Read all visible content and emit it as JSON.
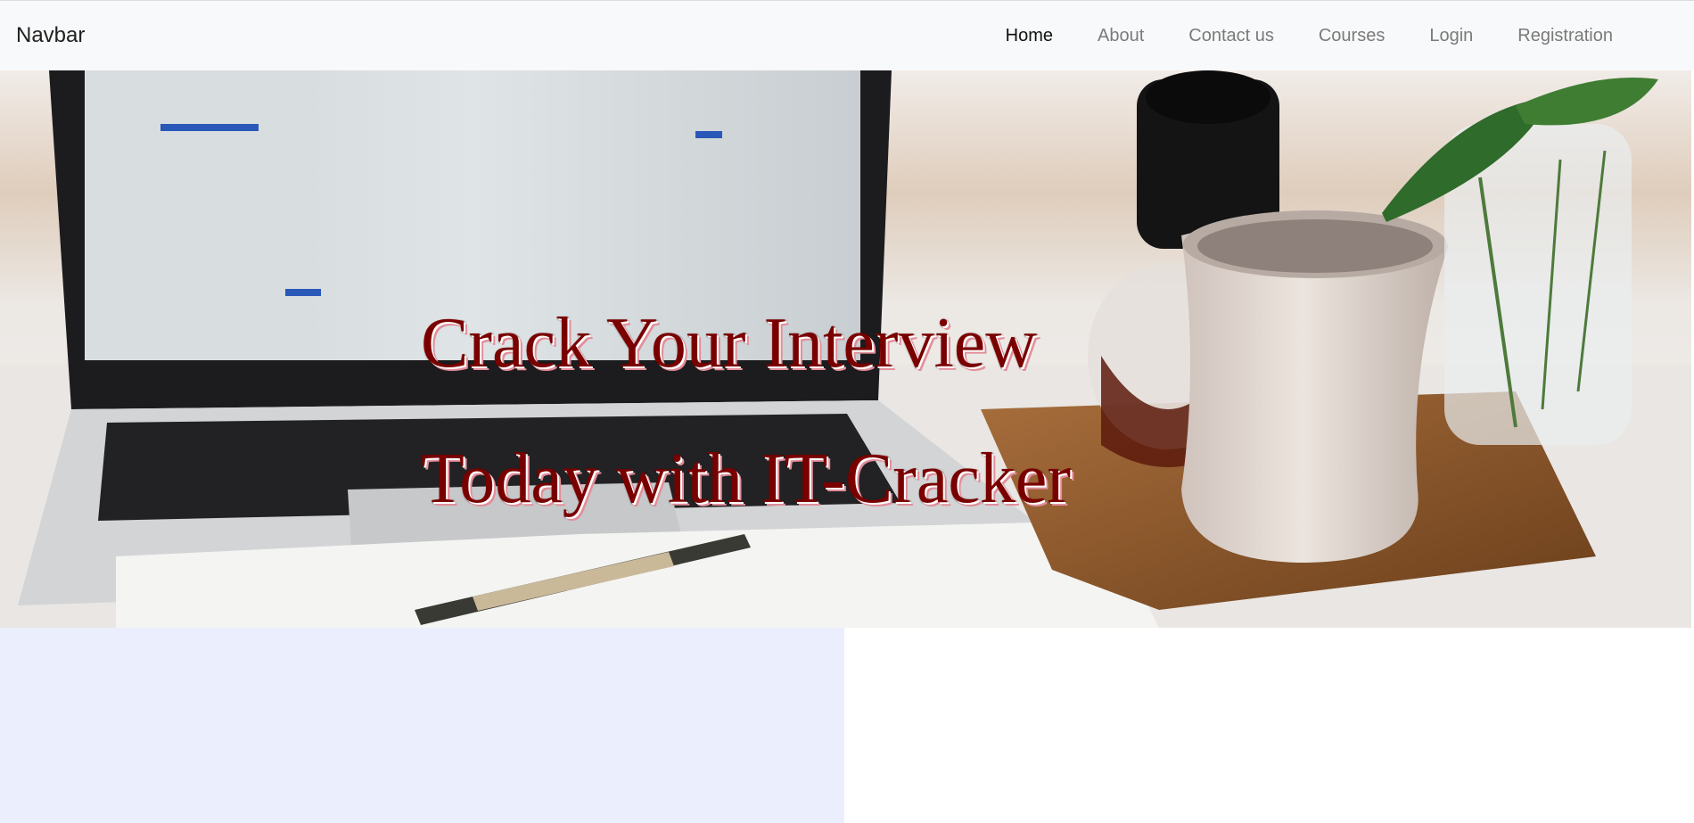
{
  "navbar": {
    "brand": "Navbar",
    "links": [
      {
        "label": "Home",
        "active": true
      },
      {
        "label": "About",
        "active": false
      },
      {
        "label": "Contact us",
        "active": false
      },
      {
        "label": "Courses",
        "active": false
      },
      {
        "label": "Login",
        "active": false
      },
      {
        "label": "Registration",
        "active": false
      }
    ]
  },
  "hero": {
    "line1": "Crack Your Interview",
    "line2": "Today with IT-Cracker",
    "headline_color": "#7a0000"
  },
  "colors": {
    "navbar_bg": "#f8f9fa",
    "nav_link": "#7a7a7a",
    "nav_link_active": "#111111",
    "lower_left_panel": "#ebeefc"
  }
}
